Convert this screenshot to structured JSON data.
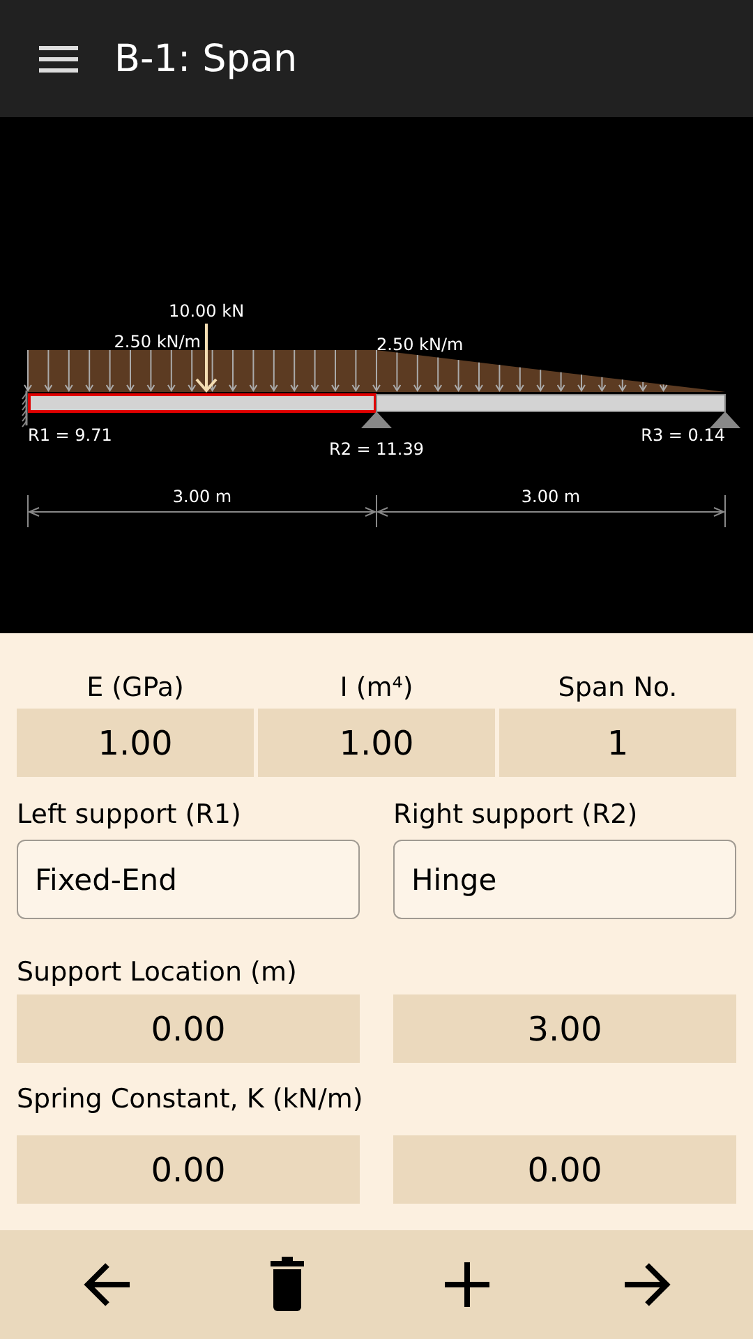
{
  "app_bar": {
    "title": "B-1: Span"
  },
  "diagram": {
    "point_load": {
      "label": "10.00 kN"
    },
    "spans": [
      {
        "length": "3.00 m",
        "selected": true,
        "load": "2.50 kN/m",
        "kind": "uniform"
      },
      {
        "length": "3.00 m",
        "selected": false,
        "load": "2.50 kN/m",
        "kind": "decreasing"
      }
    ],
    "supports": [
      {
        "kind": "fixed",
        "reaction": "R1 = 9.71"
      },
      {
        "kind": "hinge",
        "reaction": "R2 = 11.39"
      },
      {
        "kind": "hinge",
        "reaction": "R3 = 0.14"
      }
    ]
  },
  "properties": [
    {
      "label": "E (GPa)",
      "value": "1.00"
    },
    {
      "label": "I (m⁴)",
      "value": "1.00"
    },
    {
      "label": "Span No.",
      "value": "1"
    }
  ],
  "supports_form": [
    {
      "label": "Left support (R1)",
      "value": "Fixed-End"
    },
    {
      "label": "Right support (R2)",
      "value": "Hinge"
    }
  ],
  "support_location": {
    "label": "Support Location (m)",
    "values": [
      "0.00",
      "3.00"
    ]
  },
  "spring_constant": {
    "label": "Spring Constant, K (kN/m)",
    "values": [
      "0.00",
      "0.00"
    ]
  },
  "toolbar": [
    {
      "kind": "back"
    },
    {
      "kind": "delete"
    },
    {
      "kind": "add"
    },
    {
      "kind": "forward"
    }
  ]
}
